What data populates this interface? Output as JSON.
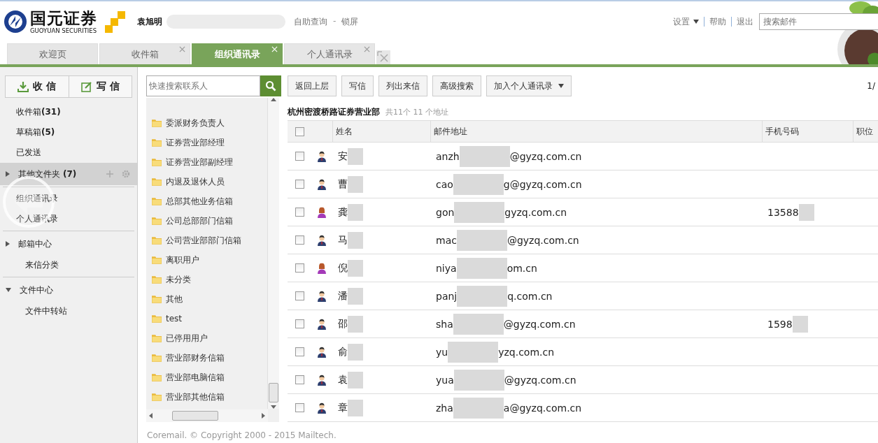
{
  "header": {
    "logo_cn": "国元证券",
    "logo_en": "GUOYUAN SECURITIES",
    "user": "袁旭明",
    "links": [
      "自助查询",
      "-",
      "锁屏"
    ],
    "menu": [
      {
        "label": "设置",
        "dropdown": true
      },
      {
        "label": "帮助",
        "dropdown": false
      },
      {
        "label": "退出",
        "dropdown": false
      }
    ],
    "search": {
      "placeholder": "搜索邮件"
    }
  },
  "tabs": [
    {
      "label": "欢迎页",
      "selected": false,
      "closable": false
    },
    {
      "label": "收件箱",
      "selected": false,
      "closable": true
    },
    {
      "label": "组织通讯录",
      "selected": true,
      "closable": true
    },
    {
      "label": "个人通讯录",
      "selected": false,
      "closable": true
    }
  ],
  "sidebar": {
    "buttons": [
      {
        "label": "收 信",
        "kind": "download"
      },
      {
        "label": "写 信",
        "kind": "compose"
      }
    ],
    "items": [
      {
        "kind": "folder",
        "label": "收件箱",
        "count": "(31)",
        "selected": false
      },
      {
        "kind": "folder",
        "label": "草稿箱",
        "count": "(5)",
        "selected": false
      },
      {
        "kind": "folder",
        "label": "已发送",
        "selected": false
      },
      {
        "kind": "group",
        "label": "其他文件夹",
        "count": "(7)",
        "expanded": false,
        "selected": true
      },
      {
        "kind": "divider"
      },
      {
        "kind": "folder",
        "label": "组织通讯录",
        "selected": false
      },
      {
        "kind": "folder",
        "label": "个人通讯录",
        "selected": false
      },
      {
        "kind": "divider"
      },
      {
        "kind": "group",
        "label": "邮箱中心",
        "expanded": false,
        "selected": false
      },
      {
        "kind": "sub",
        "label": "来信分类",
        "selected": false
      },
      {
        "kind": "divider"
      },
      {
        "kind": "group",
        "label": "文件中心",
        "expanded": true,
        "selected": false
      },
      {
        "kind": "sub",
        "label": "文件中转站",
        "selected": false
      }
    ]
  },
  "tree": {
    "search": {
      "placeholder": "快速搜索联系人"
    },
    "items": [
      "委派财务负责人",
      "证券营业部经理",
      "证券营业部副经理",
      "内退及退休人员",
      "总部其他业务信箱",
      "公司总部部门信箱",
      "公司营业部部门信箱",
      "离职用户",
      "未分类",
      "其他",
      "test",
      "已停用用户",
      "营业部财务信箱",
      "营业部电脑信箱",
      "营业部其他信箱"
    ]
  },
  "toolbar": [
    {
      "label": "返回上层",
      "dropdown": false
    },
    {
      "label": "写信",
      "dropdown": false
    },
    {
      "label": "列出来信",
      "dropdown": false
    },
    {
      "label": "高级搜索",
      "dropdown": false
    },
    {
      "label": "加入个人通讯录",
      "dropdown": true
    }
  ],
  "pager": "1/",
  "group": {
    "title": "杭州密渡桥路证券营业部",
    "summary": "共11个 11 个地址"
  },
  "table": {
    "select_all_checked": false,
    "columns": [
      "姓名",
      "邮件地址",
      "手机号码",
      "职位"
    ],
    "rows": [
      {
        "checked": false,
        "kind": "male",
        "name": "安",
        "email_head": "anzh",
        "email_tail": "@gyzq.com.cn"
      },
      {
        "checked": false,
        "kind": "male",
        "name": "曹",
        "email_head": "cao",
        "email_tail": "g@gyzq.com.cn"
      },
      {
        "checked": false,
        "kind": "female",
        "name": "龚",
        "email_head": "gon",
        "email_tail": "gyzq.com.cn",
        "phone": "13588"
      },
      {
        "checked": false,
        "kind": "male",
        "name": "马",
        "email_head": "mac",
        "email_tail": "@gyzq.com.cn"
      },
      {
        "checked": false,
        "kind": "female",
        "name": "倪",
        "email_head": "niya",
        "email_tail": "om.cn"
      },
      {
        "checked": false,
        "kind": "male",
        "name": "潘",
        "email_head": "panj",
        "email_tail": "q.com.cn"
      },
      {
        "checked": false,
        "kind": "male",
        "name": "邵",
        "email_head": "sha",
        "email_tail": "@gyzq.com.cn",
        "phone": "1598"
      },
      {
        "checked": false,
        "kind": "male",
        "name": "俞",
        "email_head": "yu",
        "email_tail": "yzq.com.cn"
      },
      {
        "checked": false,
        "kind": "male",
        "name": "袁",
        "email_head": "yua",
        "email_tail": "@gyzq.com.cn"
      },
      {
        "checked": false,
        "kind": "male",
        "name": "章",
        "email_head": "zha",
        "email_tail": "a@gyzq.com.cn"
      }
    ]
  },
  "footer": "Coremail. © Copyright 2000 - 2015 Mailtech."
}
